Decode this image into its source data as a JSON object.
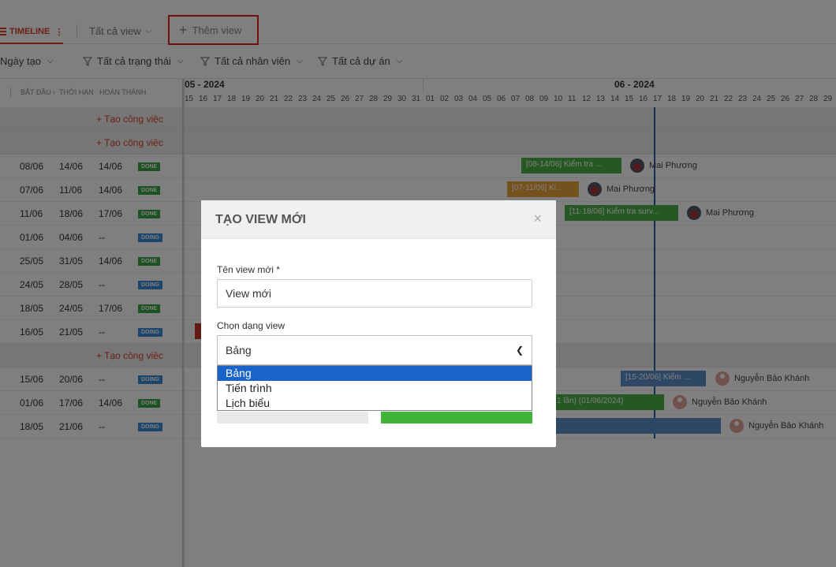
{
  "tabs": {
    "timeline_label": "TIMELINE",
    "all_views_label": "Tất cả view",
    "add_view_label": "Thêm view"
  },
  "filters": [
    {
      "label": "Ngày tạo"
    },
    {
      "label": "Tất cả trạng thái"
    },
    {
      "label": "Tất cả nhân viên"
    },
    {
      "label": "Tất cả dự án"
    }
  ],
  "table_header": {
    "start": "BẮT ĐẦU",
    "deadline": "THỜI HẠN",
    "done": "HOÀN THÀNH"
  },
  "create_task_label": "Tạo công việc",
  "rows": [
    {
      "type": "group"
    },
    {
      "type": "group"
    },
    {
      "type": "task",
      "start": "08/06",
      "deadline": "14/06",
      "done": "14/06",
      "status": "DONE"
    },
    {
      "type": "task",
      "start": "07/06",
      "deadline": "11/06",
      "done": "14/06",
      "status": "DONE"
    },
    {
      "type": "task",
      "start": "11/06",
      "deadline": "18/06",
      "done": "17/06",
      "status": "DONE"
    },
    {
      "type": "task",
      "start": "01/06",
      "deadline": "04/06",
      "done": "--",
      "status": "DOING"
    },
    {
      "type": "task",
      "start": "25/05",
      "deadline": "31/05",
      "done": "14/06",
      "status": "DONE"
    },
    {
      "type": "task",
      "start": "24/05",
      "deadline": "28/05",
      "done": "--",
      "status": "DOING"
    },
    {
      "type": "task",
      "start": "18/05",
      "deadline": "24/05",
      "done": "17/06",
      "status": "DONE"
    },
    {
      "type": "task",
      "start": "16/05",
      "deadline": "21/05",
      "done": "--",
      "status": "DOING"
    },
    {
      "type": "group"
    },
    {
      "type": "task",
      "start": "15/06",
      "deadline": "20/06",
      "done": "--",
      "status": "DOING"
    },
    {
      "type": "task",
      "start": "01/06",
      "deadline": "17/06",
      "done": "14/06",
      "status": "DONE"
    },
    {
      "type": "task",
      "start": "18/05",
      "deadline": "21/06",
      "done": "--",
      "status": "DOING"
    }
  ],
  "timeline": {
    "months": [
      "05 - 2024",
      "06 - 2024"
    ],
    "days": [
      "15",
      "16",
      "17",
      "18",
      "19",
      "20",
      "21",
      "22",
      "23",
      "24",
      "25",
      "26",
      "27",
      "28",
      "29",
      "30",
      "31",
      "01",
      "02",
      "03",
      "04",
      "05",
      "06",
      "07",
      "08",
      "09",
      "10",
      "11",
      "12",
      "13",
      "14",
      "15",
      "16",
      "17",
      "18",
      "19",
      "20",
      "21",
      "22",
      "23",
      "24",
      "25",
      "26",
      "27",
      "28",
      "29"
    ],
    "bars": [
      {
        "text": "[08-14/06] Kiểm tra ...",
        "color": "green",
        "assignee": "Mai Phương"
      },
      {
        "text": "[07-11/06] Ki...",
        "color": "orange",
        "assignee": "Mai Phương"
      },
      {
        "text": "[11-18/06] Kiểm tra surv...",
        "color": "green",
        "assignee": "Mai Phương"
      },
      {
        "text": "[15-20/06] Kiểm ...",
        "color": "blue",
        "assignee": "Nguyễn Bảo Khánh"
      },
      {
        "text": "1 lần) (01/06/2024)",
        "color": "green",
        "assignee": "Nguyễn Bảo Khánh"
      },
      {
        "text": "",
        "color": "blue",
        "assignee": "Nguyễn Bảo Khánh"
      }
    ]
  },
  "modal": {
    "title": "TẠO VIEW MỚI",
    "close_symbol": "×",
    "name_label": "Tên view mới *",
    "name_value": "View mới",
    "type_label": "Chọn dạng view",
    "type_selected": "Bảng",
    "type_options": [
      "Bảng",
      "Tiến trình",
      "Lịch biểu"
    ]
  }
}
